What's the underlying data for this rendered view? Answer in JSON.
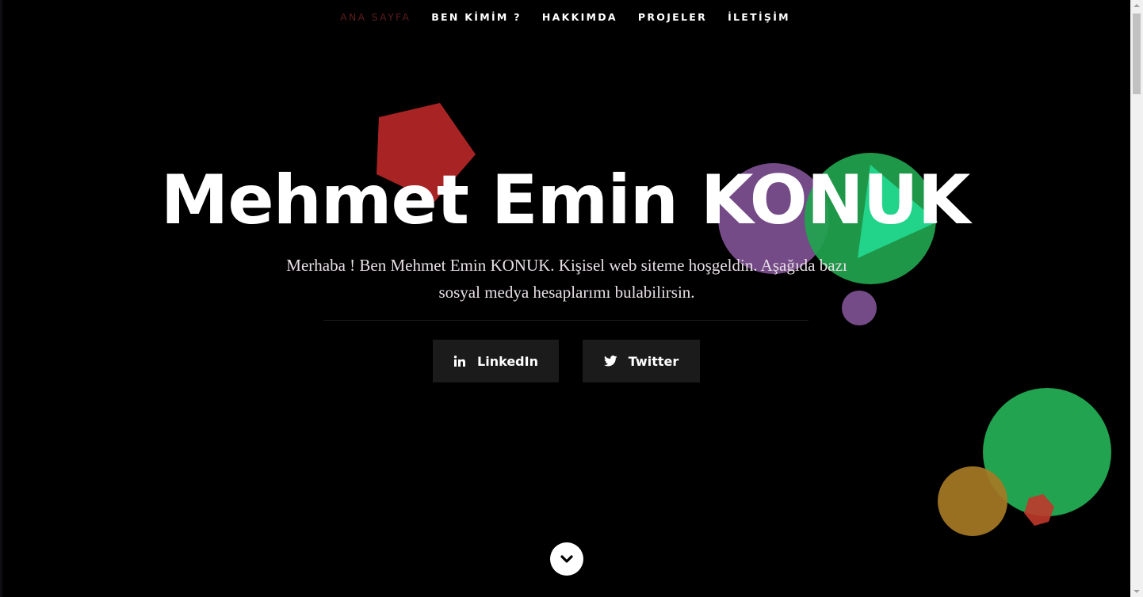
{
  "nav": {
    "items": [
      {
        "label": "ANA SAYFA",
        "active": true
      },
      {
        "label": "BEN KİMİM ?",
        "active": false
      },
      {
        "label": "HAKKIMDA",
        "active": false
      },
      {
        "label": "PROJELER",
        "active": false
      },
      {
        "label": "İLETİŞİM",
        "active": false
      }
    ]
  },
  "hero": {
    "title": "Mehmet Emin KONUK",
    "text": "Merhaba ! Ben Mehmet Emin KONUK. Kişisel web siteme hoşgeldin. Aşağıda bazı sosyal medya hesaplarımı bulabilirsin.",
    "buttons": {
      "linkedin": {
        "label": "LinkedIn",
        "icon": "linkedin-icon"
      },
      "twitter": {
        "label": "Twitter",
        "icon": "twitter-icon"
      }
    },
    "scroll_icon": "chevron-down-icon"
  },
  "colors": {
    "background": "#000000",
    "nav_active": "#5a1c1c",
    "button_bg": "#1b1b1b",
    "shape_red": "#a82424",
    "shape_purple": "#744b87",
    "shape_green": "#21a34f",
    "shape_teal": "#22d38a",
    "shape_gold": "#a67a25"
  }
}
